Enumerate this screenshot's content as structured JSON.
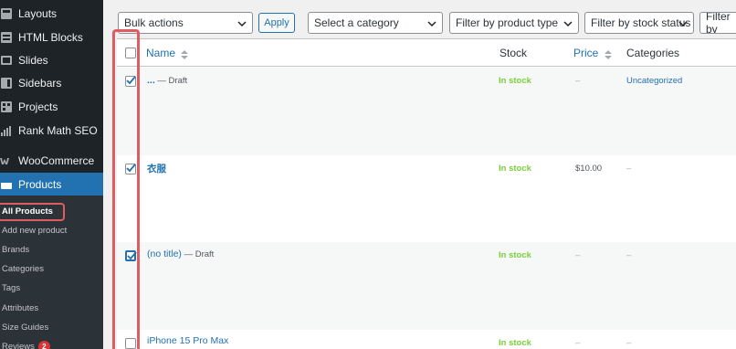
{
  "sidebar": {
    "items": [
      {
        "label": "Layouts",
        "icon": "layouts-icon"
      },
      {
        "label": "HTML Blocks",
        "icon": "html-blocks-icon"
      },
      {
        "label": "Slides",
        "icon": "slides-icon"
      },
      {
        "label": "Sidebars",
        "icon": "sidebars-icon"
      },
      {
        "label": "Projects",
        "icon": "projects-icon"
      },
      {
        "label": "Rank Math SEO",
        "icon": "rank-math-icon"
      },
      {
        "label": "WooCommerce",
        "icon": "woocommerce-icon"
      },
      {
        "label": "Products",
        "icon": "products-icon"
      }
    ],
    "submenu": [
      {
        "label": "All Products"
      },
      {
        "label": "Add new product"
      },
      {
        "label": "Brands"
      },
      {
        "label": "Categories"
      },
      {
        "label": "Tags"
      },
      {
        "label": "Attributes"
      },
      {
        "label": "Size Guides"
      },
      {
        "label": "Reviews",
        "badge": "2"
      }
    ]
  },
  "toolbar": {
    "bulk_actions": "Bulk actions",
    "apply": "Apply",
    "category_filter": "Select a category",
    "type_filter": "Filter by product type",
    "stock_filter": "Filter by stock status",
    "extra_filter": "Filter by"
  },
  "table": {
    "headers": {
      "name": "Name",
      "stock": "Stock",
      "price": "Price",
      "categories": "Categories"
    },
    "rows": [
      {
        "checked": true,
        "name": "...",
        "state": " — Draft",
        "stock": "In stock",
        "price": "–",
        "categories": "Uncategorized"
      },
      {
        "checked": true,
        "name": "衣服",
        "state": "",
        "stock": "In stock",
        "price": "$10.00",
        "categories": "–"
      },
      {
        "checked": true,
        "name": "(no title)",
        "state": " — Draft",
        "stock": "In stock",
        "price": "–",
        "categories": "–"
      },
      {
        "checked": false,
        "name": "iPhone 15 Pro Max",
        "state": "",
        "stock": "In stock",
        "price": "–",
        "categories": "–"
      }
    ]
  },
  "colors": {
    "sidebar_bg": "#1d2327",
    "active": "#2271b1",
    "in_stock": "#7ad03a",
    "highlight": "#e15c61"
  }
}
